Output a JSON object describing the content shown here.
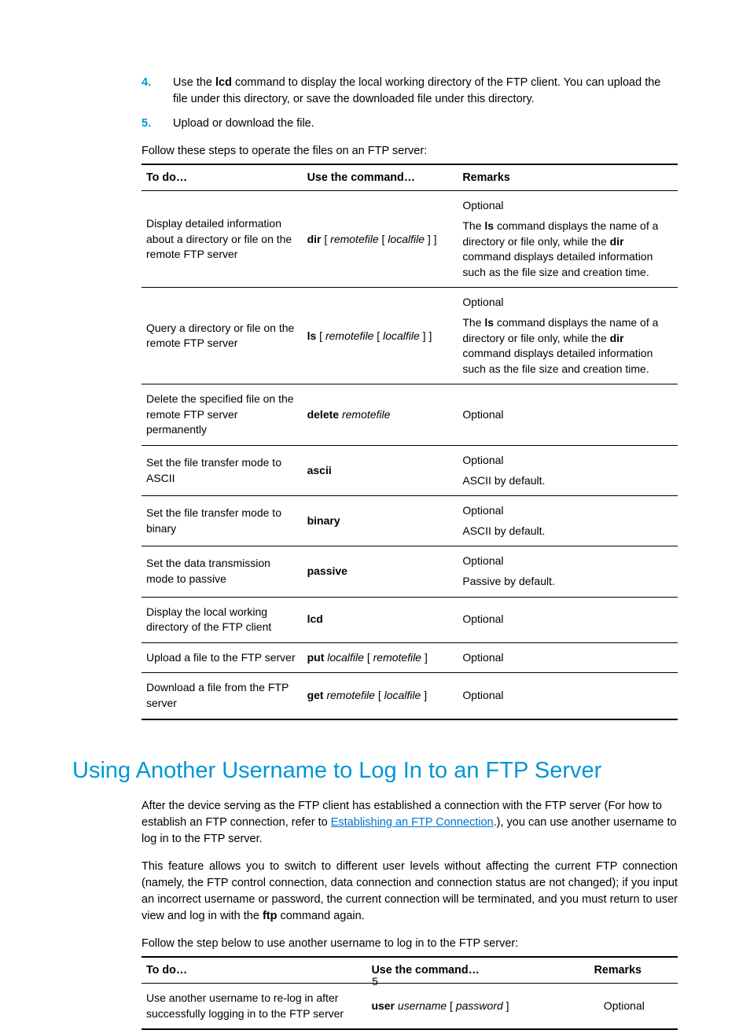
{
  "list": {
    "item4_a": "Use the ",
    "item4_b": "lcd",
    "item4_c": " command to display the local working directory of the FTP client. You can upload the file under this directory, or save the downloaded file under this directory.",
    "item5": "Upload or download the file."
  },
  "table1_intro": "Follow these steps to operate the files on an FTP server:",
  "table1": {
    "headers": {
      "c1": "To do…",
      "c2": "Use the command…",
      "c3": "Remarks"
    },
    "rows": [
      {
        "todo": "Display detailed information about a directory or file on the remote FTP server",
        "cmd": {
          "b": "dir",
          "rest": " [ ",
          "i1": "remotefile",
          "mid": " [ ",
          "i2": "localfile",
          "end": " ] ]"
        },
        "rem": {
          "p1": "Optional",
          "p2a": "The ",
          "p2b": "ls",
          "p2c": " command displays the name of a directory or file only, while the ",
          "p2d": "dir",
          "p2e": " command displays detailed information such as the file size and creation time."
        }
      },
      {
        "todo": "Query a directory or file on the remote FTP server",
        "cmd": {
          "b": "ls",
          "rest": " [ ",
          "i1": "remotefile",
          "mid": " [ ",
          "i2": "localfile",
          "end": " ] ]"
        },
        "rem": {
          "p1": "Optional",
          "p2a": "The ",
          "p2b": "ls",
          "p2c": " command displays the name of a directory or file only, while the ",
          "p2d": "dir",
          "p2e": " command displays detailed information such as the file size and creation time."
        }
      },
      {
        "todo": "Delete the specified file on the remote FTP server permanently",
        "cmd": {
          "b": "delete",
          "rest": " ",
          "i1": "remotefile",
          "mid": "",
          "i2": "",
          "end": ""
        },
        "rem": {
          "p1": "Optional"
        }
      },
      {
        "todo": "Set the file transfer mode to ASCII",
        "cmd": {
          "b": "ascii",
          "rest": "",
          "i1": "",
          "mid": "",
          "i2": "",
          "end": ""
        },
        "rem": {
          "p1": "Optional",
          "p2": "ASCII by default."
        }
      },
      {
        "todo": "Set the file transfer mode to binary",
        "cmd": {
          "b": "binary",
          "rest": "",
          "i1": "",
          "mid": "",
          "i2": "",
          "end": ""
        },
        "rem": {
          "p1": "Optional",
          "p2": "ASCII by default."
        }
      },
      {
        "todo": "Set the data transmission mode to passive",
        "cmd": {
          "b": "passive",
          "rest": "",
          "i1": "",
          "mid": "",
          "i2": "",
          "end": ""
        },
        "rem": {
          "p1": "Optional",
          "p2": "Passive by default."
        }
      },
      {
        "todo": "Display the local working directory of the FTP client",
        "cmd": {
          "b": "lcd",
          "rest": "",
          "i1": "",
          "mid": "",
          "i2": "",
          "end": ""
        },
        "rem": {
          "p1": "Optional"
        }
      },
      {
        "todo": "Upload a file to the FTP server",
        "cmd": {
          "b": "put",
          "rest": " ",
          "i1": "localfile",
          "mid": " [ ",
          "i2": "remotefile",
          "end": " ]"
        },
        "rem": {
          "p1": "Optional"
        }
      },
      {
        "todo": "Download a file from the FTP server",
        "cmd": {
          "b": "get",
          "rest": " ",
          "i1": "remotefile",
          "mid": " [ ",
          "i2": "localfile",
          "end": " ]"
        },
        "rem": {
          "p1": "Optional"
        }
      }
    ]
  },
  "heading": "Using Another Username to Log In to an FTP Server",
  "para1": {
    "a": "After the device serving as the FTP client has established a connection with the FTP server (For how to establish an FTP connection, refer to ",
    "link": "Establishing an FTP Connection",
    "b": ".), you can use another username to log in to the FTP server."
  },
  "para2": {
    "a": "This feature allows you to switch to different user levels without affecting the current FTP connection (namely, the FTP control connection, data connection and connection status are not changed); if you input an incorrect username or password, the current connection will be terminated, and you must return to user view and log in with the ",
    "b": "ftp",
    "c": " command again."
  },
  "table2_intro": "Follow the step below to use another username to log in to the FTP server:",
  "table2": {
    "headers": {
      "c1": "To do…",
      "c2": "Use the command…",
      "c3": "Remarks"
    },
    "row": {
      "todo": "Use another username to re-log in after successfully logging in to the FTP server",
      "cmd": {
        "b": "user",
        "rest": " ",
        "i1": "username",
        "mid": " [ ",
        "i2": "password",
        "end": " ]"
      },
      "rem": "Optional"
    }
  },
  "page": "5"
}
